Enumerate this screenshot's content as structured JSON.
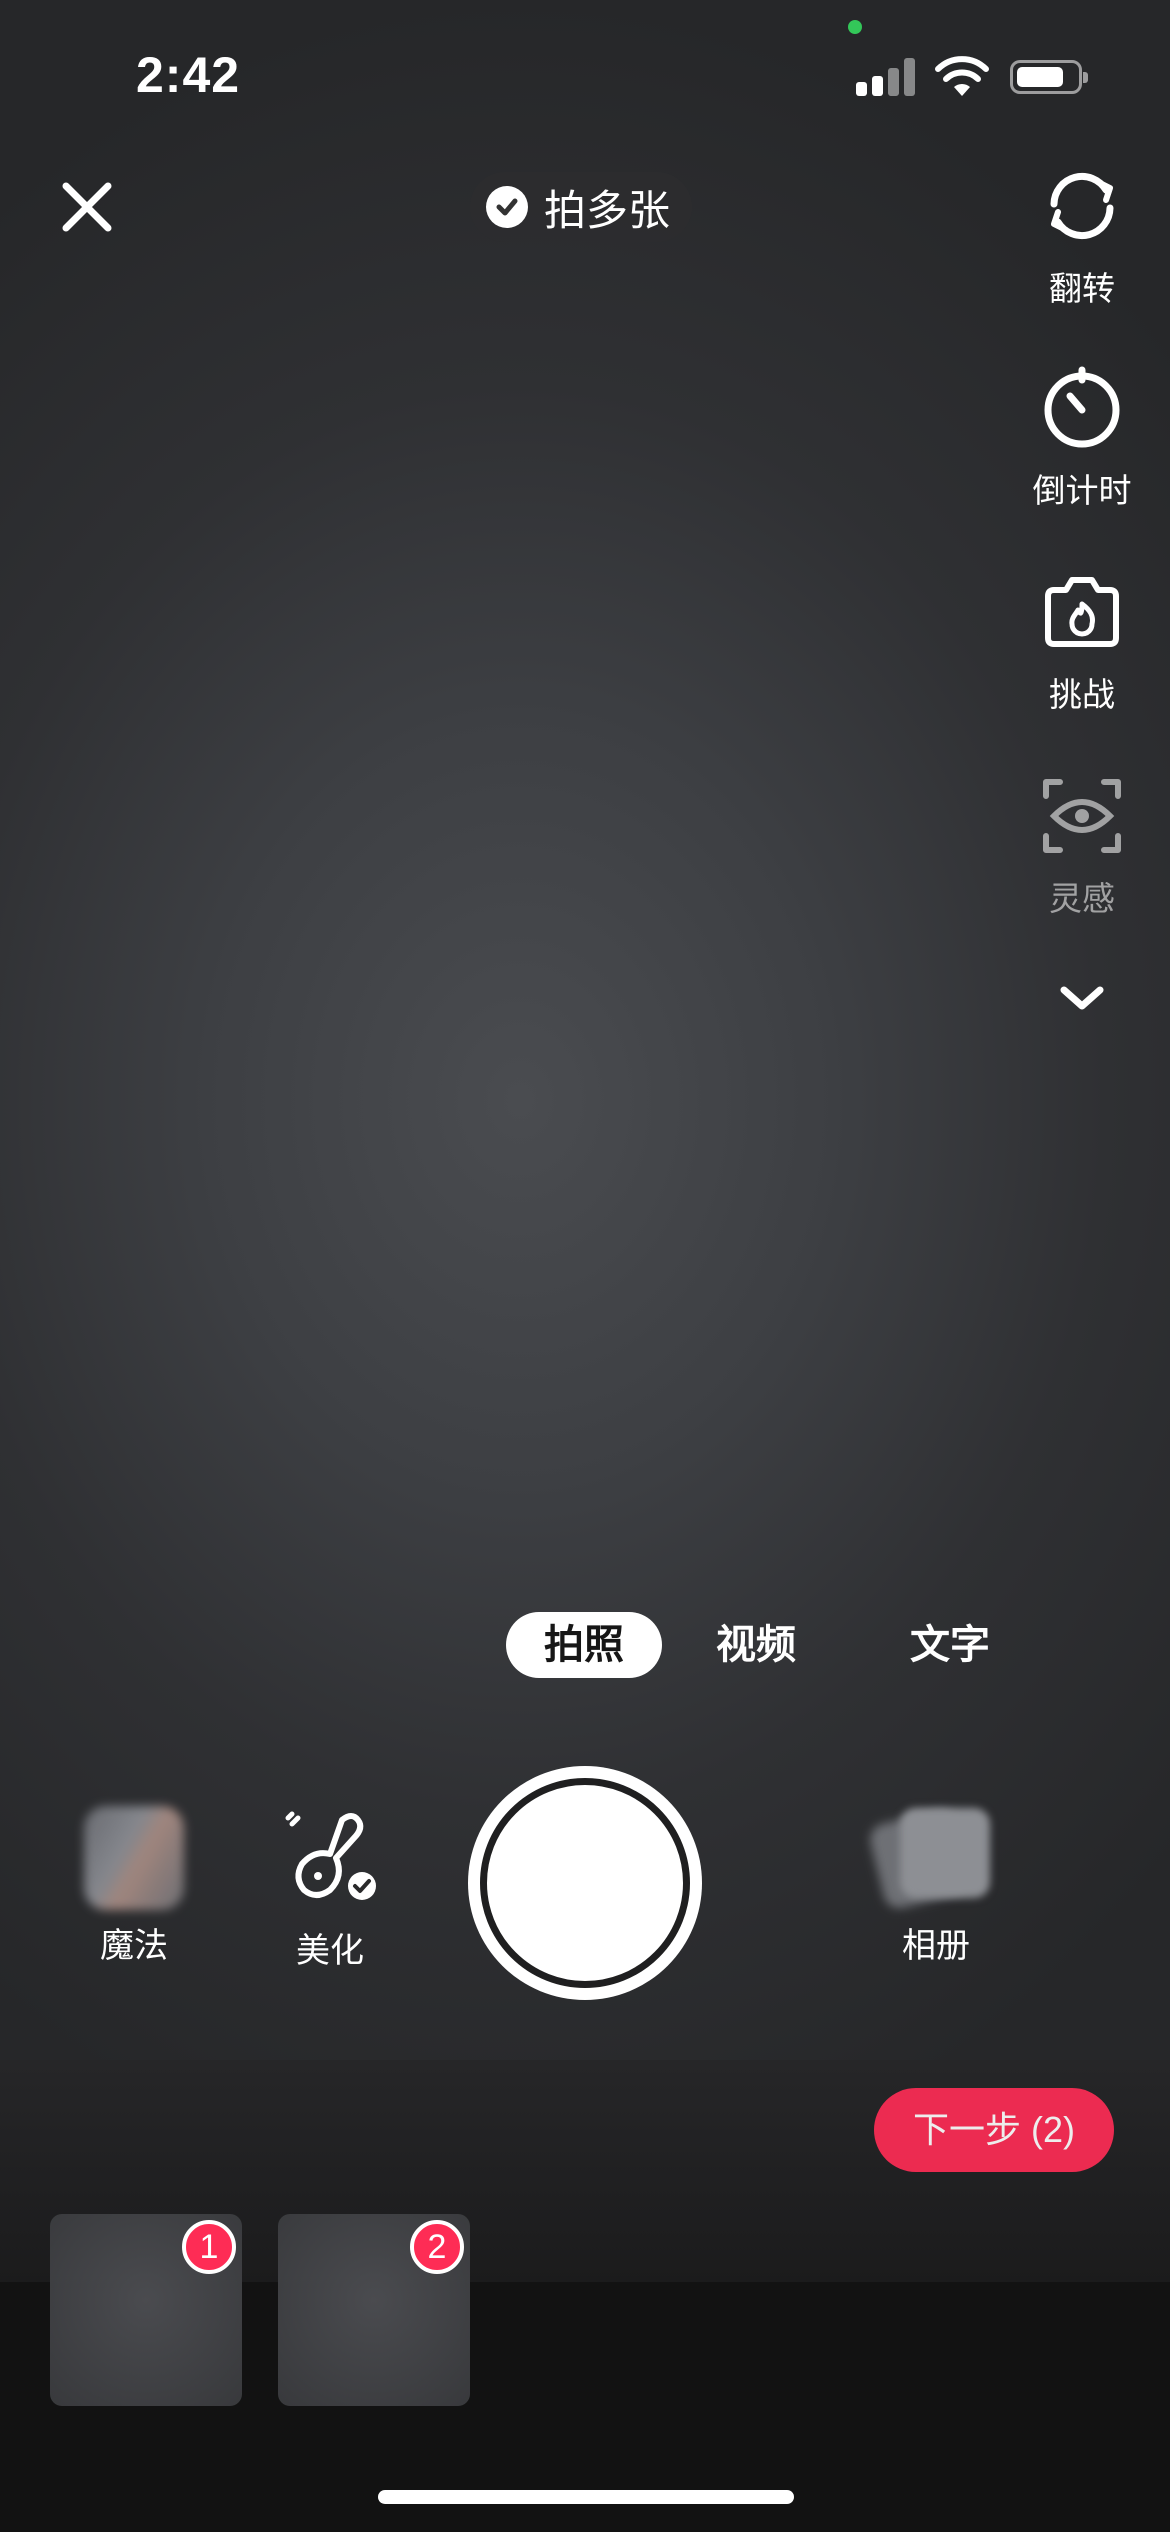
{
  "status_bar": {
    "time": "2:42"
  },
  "top_bar": {
    "multi_shot_label": "拍多张"
  },
  "right_tools": [
    {
      "id": "flip",
      "label": "翻转",
      "icon": "flip-camera-icon"
    },
    {
      "id": "timer",
      "label": "倒计时",
      "icon": "timer-icon"
    },
    {
      "id": "challenge",
      "label": "挑战",
      "icon": "challenge-camera-icon"
    },
    {
      "id": "inspiration",
      "label": "灵感",
      "icon": "eye-scan-icon"
    }
  ],
  "modes": [
    {
      "label": "拍照",
      "active": true
    },
    {
      "label": "视频",
      "active": false
    },
    {
      "label": "文字",
      "active": false
    }
  ],
  "bottom_controls": {
    "magic_label": "魔法",
    "beautify_label": "美化",
    "album_label": "相册"
  },
  "next_button": {
    "label": "下一步 (2)"
  },
  "captured": [
    {
      "index": "1"
    },
    {
      "index": "2"
    }
  ],
  "colors": {
    "accent": "#fe2c55",
    "privacy_dot": "#33c759"
  }
}
